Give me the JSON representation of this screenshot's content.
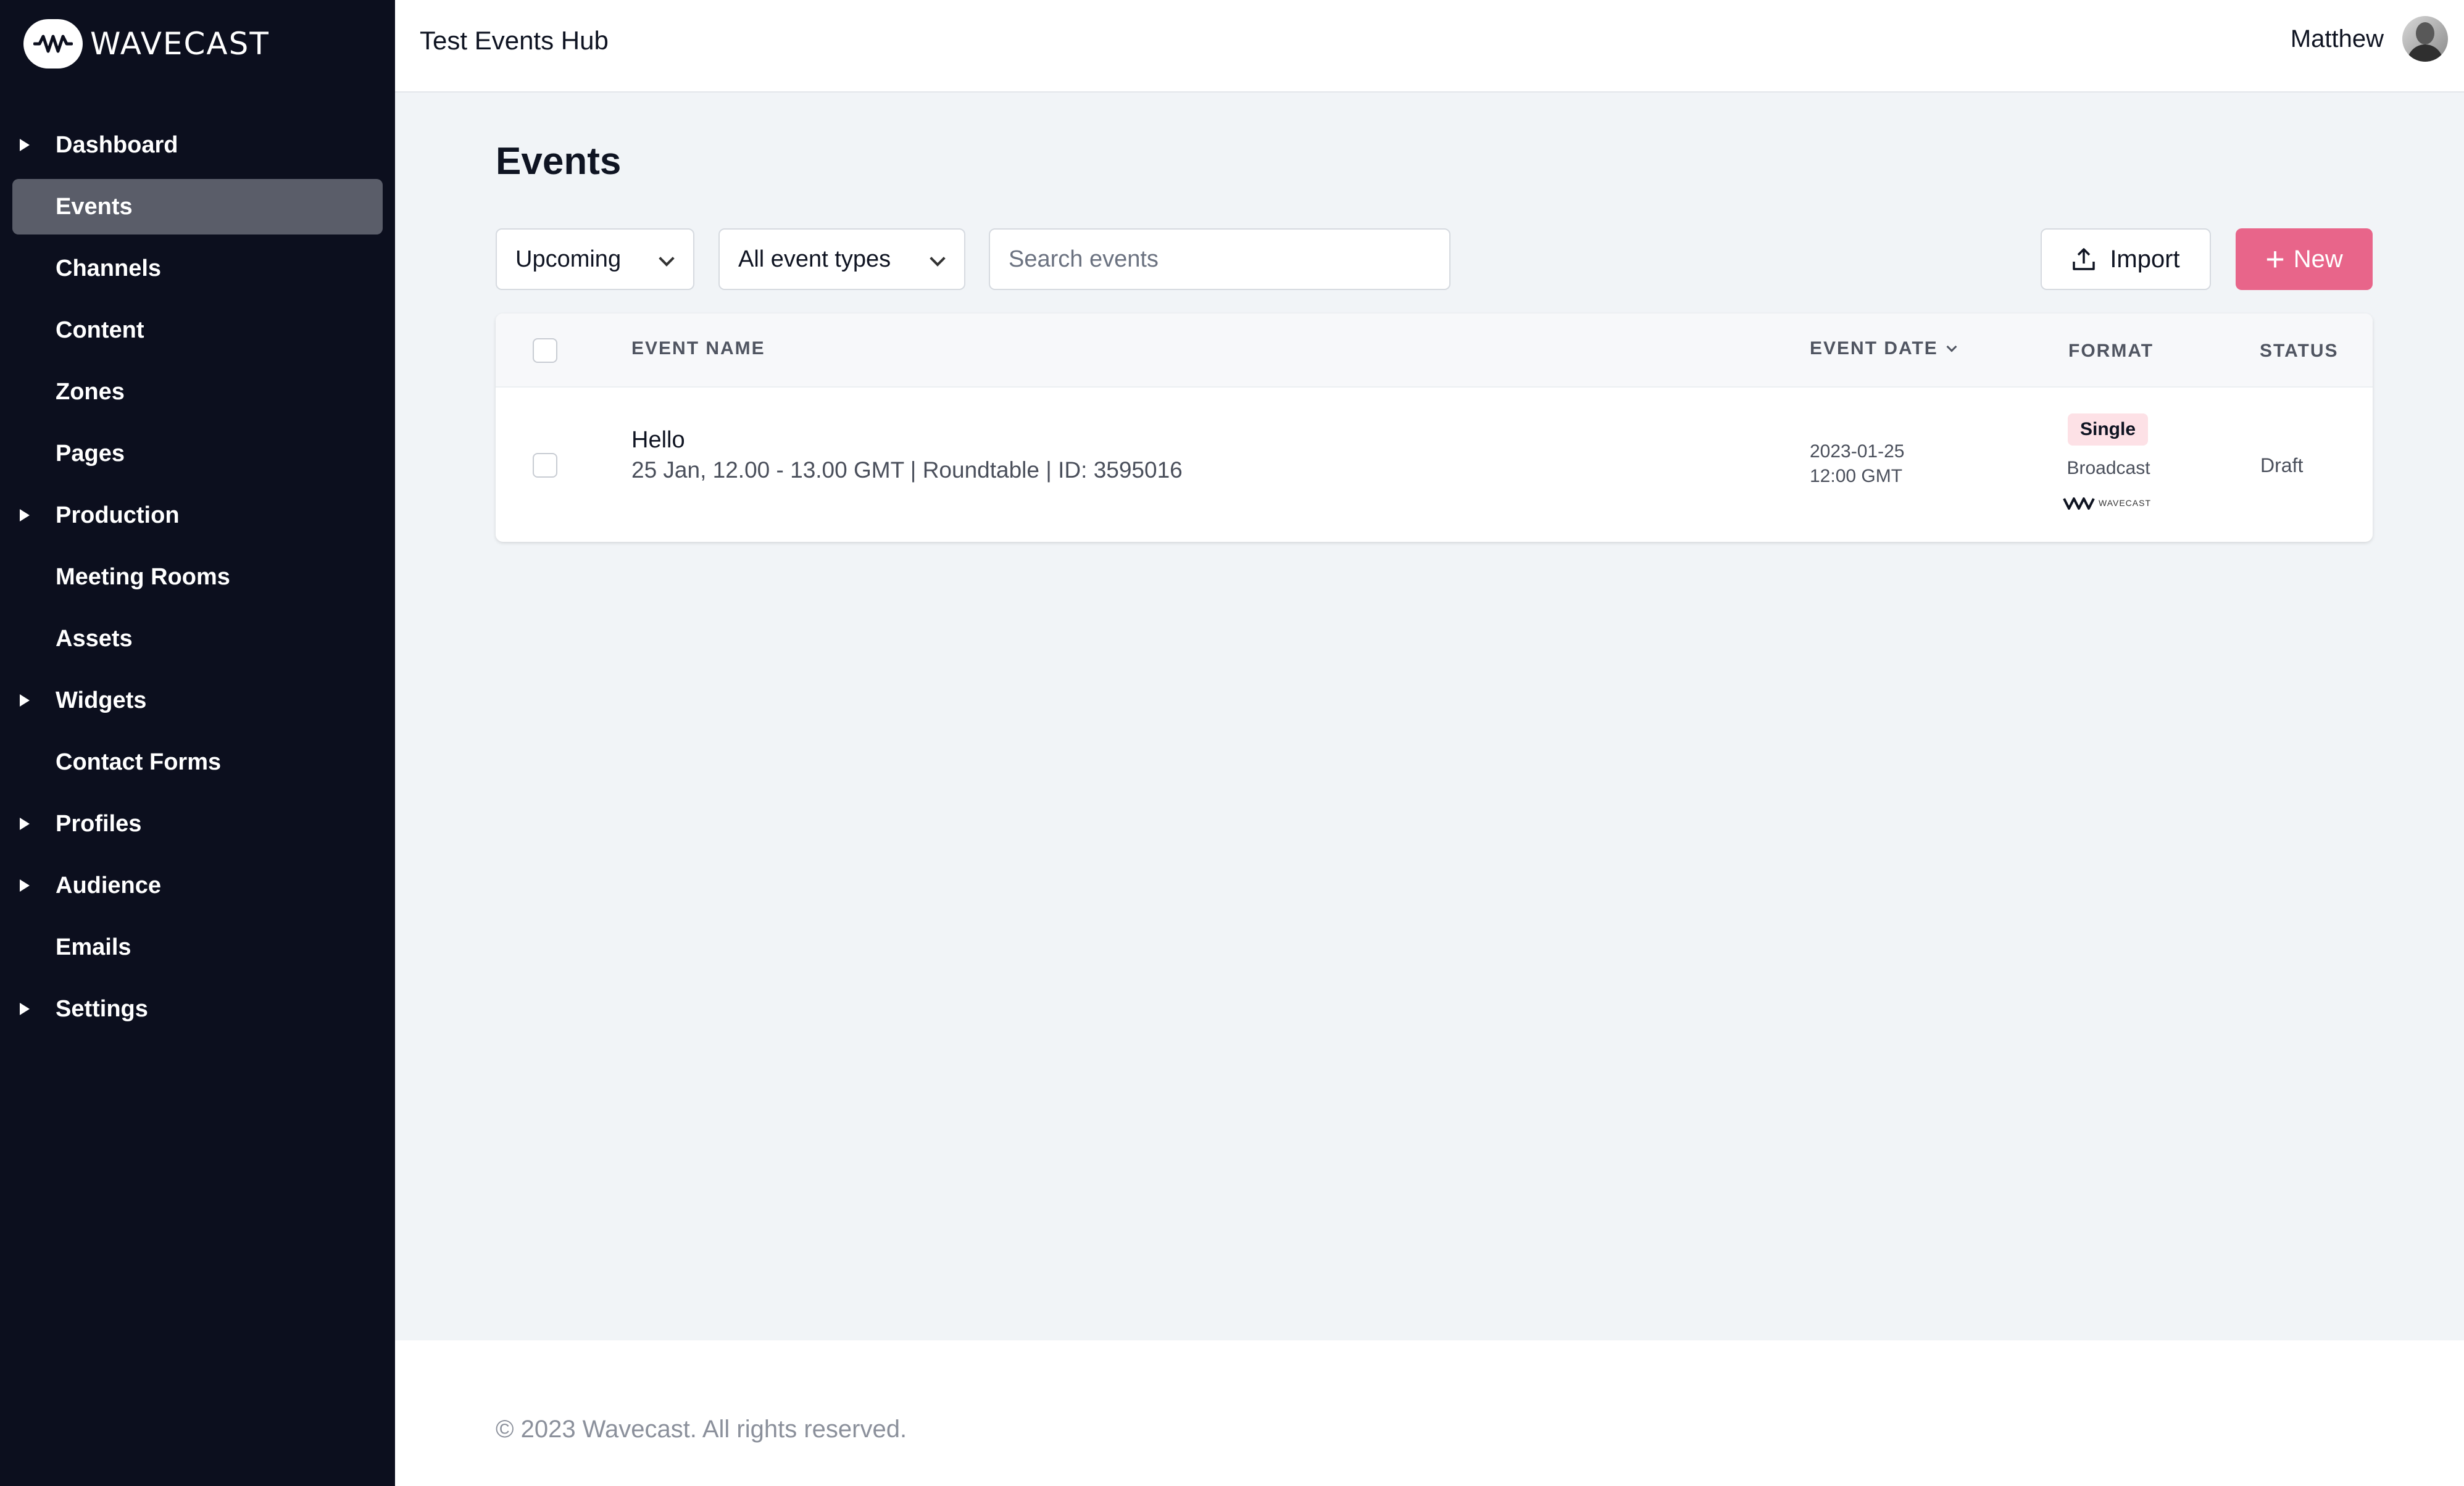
{
  "brand": {
    "name": "WAVECAST",
    "icon": "wave-icon"
  },
  "header": {
    "hub_title": "Test Events Hub",
    "user_name": "Matthew"
  },
  "sidebar": {
    "items": [
      {
        "label": "Dashboard",
        "expandable": true,
        "active": false
      },
      {
        "label": "Events",
        "expandable": false,
        "active": true
      },
      {
        "label": "Channels",
        "expandable": false,
        "active": false
      },
      {
        "label": "Content",
        "expandable": false,
        "active": false
      },
      {
        "label": "Zones",
        "expandable": false,
        "active": false
      },
      {
        "label": "Pages",
        "expandable": false,
        "active": false
      },
      {
        "label": "Production",
        "expandable": true,
        "active": false
      },
      {
        "label": "Meeting Rooms",
        "expandable": false,
        "active": false
      },
      {
        "label": "Assets",
        "expandable": false,
        "active": false
      },
      {
        "label": "Widgets",
        "expandable": true,
        "active": false
      },
      {
        "label": "Contact Forms",
        "expandable": false,
        "active": false
      },
      {
        "label": "Profiles",
        "expandable": true,
        "active": false
      },
      {
        "label": "Audience",
        "expandable": true,
        "active": false
      },
      {
        "label": "Emails",
        "expandable": false,
        "active": false
      },
      {
        "label": "Settings",
        "expandable": true,
        "active": false
      }
    ]
  },
  "main": {
    "title": "Events",
    "filters": {
      "time": "Upcoming",
      "type": "All event types",
      "search_placeholder": "Search events"
    },
    "buttons": {
      "import": "Import",
      "new": "New"
    },
    "table": {
      "columns": {
        "event_name": "EVENT NAME",
        "event_date": "EVENT DATE",
        "format": "FORMAT",
        "status": "STATUS"
      },
      "rows": [
        {
          "name": "Hello",
          "details": "25 Jan, 12.00 - 13.00 GMT | Roundtable | ID: 3595016",
          "date": "2023-01-25",
          "time": "12:00 GMT",
          "format_badge": "Single",
          "format_type": "Broadcast",
          "format_logo": "WAVECAST",
          "status": "Draft"
        }
      ]
    }
  },
  "footer": {
    "copyright": "© 2023 Wavecast. All rights reserved."
  },
  "colors": {
    "sidebar_bg": "#0c0f1e",
    "active_item_bg": "#5a5d69",
    "accent": "#e8658a",
    "badge_bg": "#fde1e6",
    "page_bg": "#f1f4f7"
  }
}
